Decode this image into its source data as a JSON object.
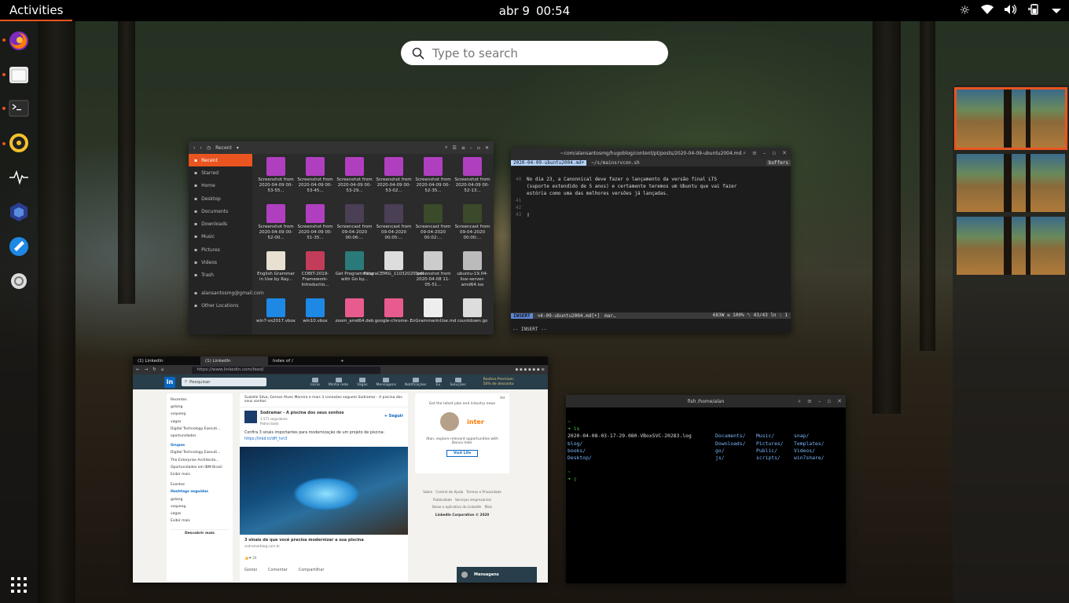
{
  "topbar": {
    "activities_label": "Activities",
    "date": "abr 9",
    "time": "00:54"
  },
  "search": {
    "placeholder": "Type to search"
  },
  "dock": {
    "items": [
      "firefox",
      "files",
      "terminal",
      "rhythmbox",
      "system-monitor",
      "virtualbox",
      "vscode",
      "settings"
    ]
  },
  "workspaces": {
    "count": 3,
    "active_index": 0
  },
  "files_window": {
    "view_label": "Recent",
    "sidebar": [
      "Recent",
      "Starred",
      "Home",
      "Desktop",
      "Documents",
      "Downloads",
      "Music",
      "Pictures",
      "Videos",
      "Trash",
      "alansantosmg@gmail.com",
      "Other Locations"
    ],
    "items": [
      "Screenshot from 2020-04-09 00-53-55...",
      "Screenshot from 2020-04-09 00-53-45...",
      "Screenshot from 2020-04-09 00-53-29...",
      "Screenshot from 2020-04-09 00-53-02...",
      "Screenshot from 2020-04-09 00-52-35...",
      "Screenshot from 2020-04-09 00-52-13...",
      "Screenshot from 2020-04-09 00-52-00...",
      "Screenshot from 2020-04-09 00-51-35...",
      "Screencast from 09-04-2020 00:06:...",
      "Screencast from 09-04-2020 00:05:...",
      "Screencast from 09-04-2020 00:02:...",
      "Screencast from 09-04-2020 00:00:...",
      "English Grammar in Use by Ray...",
      "COBIT-2019-Framework-Introductio...",
      "Get Programming with Go by...",
      "FaturaCEMIG_11032020.pdf",
      "Screenshot from 2020-04-08 11-05-51...",
      "ubuntu-19.04-live-server-amd64.iso",
      "win7-vs2017.vbox",
      "win10.vbox",
      "zoom_amd64.deb",
      "google-chrome-...",
      "EnGrammarinUse.md",
      "countdown.go"
    ]
  },
  "vim_window": {
    "title": "~com/alansantosmg/hugoblog/content/pt/posts/2020-04-09-ubuntu2004.md",
    "tab_active": "2020-04-09-ubuntu2004.md+",
    "tab_other": "~/s/mainsrvcon.sh",
    "buffers_label": "buffers",
    "lines": [
      {
        "n": "40",
        "t": "No dia 23, a Canonnical deve fazer o lançamento da versão final LTS"
      },
      {
        "n": "",
        "t": "(suporte extendido de 5 anos) e certamente teremos um Ubuntu que vai fazer"
      },
      {
        "n": "",
        "t": "estória como uma das melhores versões já lançadas."
      },
      {
        "n": "41",
        "t": ""
      },
      {
        "n": "42",
        "t": ""
      },
      {
        "n": "43",
        "t": "▯"
      }
    ],
    "status_mode": "INSERT",
    "status_file": "<4-09-ubuntu2004.md[+]",
    "status_ft": "mar…",
    "status_pos": "683W ≡ 100% ␤ 43/43 ln : 1",
    "cmdline": "-- INSERT --"
  },
  "browser_window": {
    "tabs": [
      "(1) LinkedIn",
      "(1) LinkedIn",
      "Index of /"
    ],
    "url": "https://www.linkedin.com/feed/",
    "search_placeholder": "Pesquisar",
    "nav": [
      "Início",
      "Minha rede",
      "Vagas",
      "Mensagens",
      "Notificações",
      "Eu",
      "Soluções"
    ],
    "premium": "Reative Premium: 50% de desconto",
    "left_recent_header": "Recentes",
    "left_recent": [
      "golang",
      "vsqueng",
      "vagas",
      "Digital Technology Executi...",
      "oportunidades"
    ],
    "left_groups_header": "Grupos",
    "left_groups": [
      "Digital Technology Executi...",
      "The Enterprise Architecta...",
      "Oportunidades em IBM Brasil",
      "Exibir mais"
    ],
    "left_events_header": "Eventos",
    "left_hashtags_header": "Hashtags seguidas",
    "left_hashtags": [
      "golang",
      "vsqueng",
      "vagas",
      "Exibir mais"
    ],
    "left_discover": "Descobrir mais",
    "feed_social": "Suzielle Silva, Gerson Alves Moreira e mais 3 conexões seguem Sodramar - A piscina dos seus sonhos",
    "feed_company": "Sodramar - A piscina dos seus sonhos",
    "feed_followers": "3.571 seguidores",
    "feed_promoted": "Patrocinado",
    "feed_follow": "+ Seguir",
    "feed_text": "Confira 3 sinais importantes para modernização de um projeto de piscina:",
    "feed_link": "https://lnkd.in/dH_Ivn3",
    "feed_headline": "3 sinais de que você precisa modernizar a sua piscina",
    "feed_site": "sodramarblog.com.br",
    "feed_reactions": "29",
    "feed_actions": [
      "Gostei",
      "Comentar",
      "Compartilhar"
    ],
    "ad_label": "Ad",
    "ad_tagline": "Get the latest jobs and industry news",
    "ad_brand": "inter",
    "ad_text": "Alan, explore relevant opportunities with Banco Inter",
    "ad_button": "Visit Life",
    "footer": [
      "Sobre",
      "Central de Ajuda",
      "Termos e Privacidade",
      "Publicidade",
      "Serviços empresariais",
      "Baixe o aplicativo do LinkedIn",
      "Mais"
    ],
    "copyright": "LinkedIn Corporation © 2020",
    "messages": "Mensagens"
  },
  "fish_window": {
    "title": "fish /home/alan",
    "prompt1": "~",
    "cmd": "➜ ls",
    "ls_rows": [
      [
        "2020-04-08-03-17-29.080-VBoxSVC-20283.log",
        "Documents/",
        "Music/",
        "snap/"
      ],
      [
        "blog/",
        "Downloads/",
        "Pictures/",
        "Templates/"
      ],
      [
        "books/",
        "go/",
        "Public/",
        "Videos/"
      ],
      [
        "Desktop/",
        "js/",
        "scripts/",
        "win7share/"
      ]
    ],
    "prompt2": "~",
    "prompt3": "➜ ▯"
  },
  "colors": {
    "accent": "#e95420"
  }
}
